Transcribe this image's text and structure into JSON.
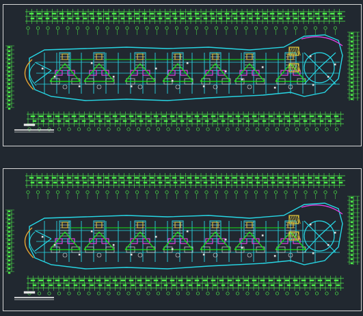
{
  "drawing": {
    "sheets": [
      {
        "id": "upper-floor-plan",
        "variant": "a"
      },
      {
        "id": "lower-floor-plan",
        "variant": "b"
      }
    ],
    "colors": {
      "background": "#212830",
      "frame": "#d8d8d8",
      "dimension": "#4ff04a",
      "wall": "#27d8e6",
      "furniture": "#e2e2e2",
      "cable": "#17e817",
      "accent_magenta": "#e040e0",
      "accent_yellow": "#f0d23a",
      "accent_orange": "#e8a530"
    },
    "icons": [
      "axis-bubble",
      "electrical-panel",
      "cable-run",
      "scale-bar"
    ]
  }
}
